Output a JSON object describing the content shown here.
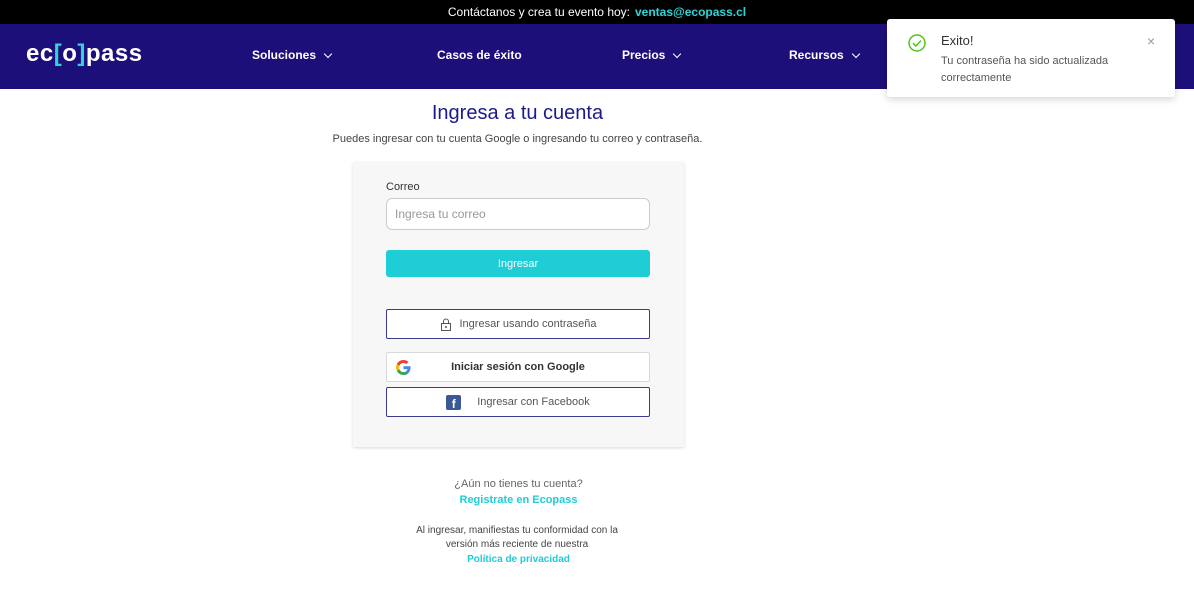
{
  "topbar": {
    "text": "Contáctanos y crea tu evento hoy:",
    "email": "ventas@ecopass.cl"
  },
  "brand": {
    "logo_prefix": "ec",
    "logo_open": "[",
    "logo_mid": "o",
    "logo_close": "]",
    "logo_suffix": "pass"
  },
  "nav": {
    "items": [
      {
        "label": "Soluciones",
        "has_dropdown": true
      },
      {
        "label": "Casos de éxito",
        "has_dropdown": false
      },
      {
        "label": "Precios",
        "has_dropdown": true
      },
      {
        "label": "Recursos",
        "has_dropdown": true
      }
    ]
  },
  "main": {
    "title": "Ingresa a tu cuenta",
    "subtitle": "Puedes ingresar con tu cuenta Google o ingresando tu correo y contraseña."
  },
  "form": {
    "email_label": "Correo",
    "email_placeholder": "Ingresa tu correo",
    "email_value": "",
    "submit_label": "Ingresar",
    "password_btn": "Ingresar usando contraseña",
    "google_btn": "Iniciar sesión con Google",
    "facebook_btn": "Ingresar con Facebook"
  },
  "footer": {
    "question": "¿Aún no tienes tu cuenta?",
    "register_link": "Registrate en Ecopass",
    "legal_line1": "Al ingresar, manifiestas tu conformidad con la",
    "legal_line2": "versión más reciente de nuestra",
    "privacy_link": "Política de privacidad"
  },
  "toast": {
    "title": "Exito!",
    "message": "Tu contraseña ha sido actualizada correctamente",
    "close": "×"
  },
  "colors": {
    "nav_bg": "#1c0f7a",
    "accent": "#1fcdd6",
    "title": "#1c1a8a",
    "success": "#52c41a"
  }
}
